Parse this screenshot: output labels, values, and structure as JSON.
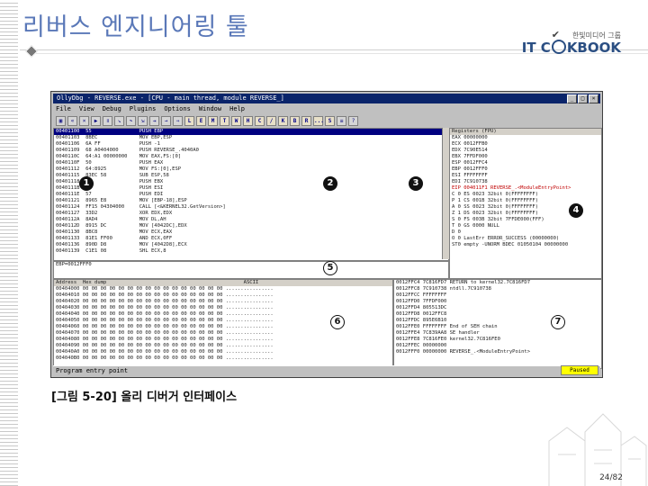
{
  "slide": {
    "title": "리버스 엔지니어링 툴",
    "caption": "[그림 5-20] 올리 디버거 인터페이스",
    "page": "24/82",
    "logo_small": "한빛미디어 그룹",
    "logo_big_prefix": "IT C",
    "logo_big_suffix": "KBOOK"
  },
  "window": {
    "title": "OllyDbg - REVERSE.exe - [CPU - main thread, module REVERSE_]",
    "menu": [
      "File",
      "View",
      "Debug",
      "Plugins",
      "Options",
      "Window",
      "Help"
    ],
    "toolbar_letters": [
      "L",
      "E",
      "M",
      "T",
      "W",
      "H",
      "C",
      "/",
      "K",
      "B",
      "R",
      "...",
      "S"
    ],
    "status": "Program entry point",
    "paused": "Paused",
    "regs_header": "Registers (FPU)",
    "address_header": "Address",
    "hex_header": "Hex dump",
    "ascii_header": "ASCII"
  },
  "badges": [
    {
      "id": "1",
      "style": "dark"
    },
    {
      "id": "2",
      "style": "dark"
    },
    {
      "id": "3",
      "style": "dark"
    },
    {
      "id": "4",
      "style": "dark"
    },
    {
      "id": "5",
      "style": "ring"
    },
    {
      "id": "6",
      "style": "ring"
    },
    {
      "id": "7",
      "style": "ring"
    }
  ]
}
